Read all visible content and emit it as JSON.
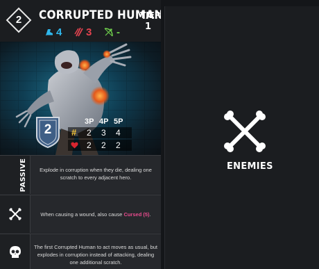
{
  "card": {
    "level": "2",
    "name": "CORRUPTED HUMAN",
    "tier_label": "TIER",
    "tier_value": "1",
    "stats": {
      "move": "4",
      "melee": "3",
      "ranged": "-"
    },
    "defense": "2",
    "player_counts": [
      "3P",
      "4P",
      "5P"
    ],
    "rows": [
      {
        "icon": "hash-icon",
        "values": [
          "2",
          "3",
          "4"
        ]
      },
      {
        "icon": "heart-icon",
        "values": [
          "2",
          "2",
          "2"
        ]
      }
    ],
    "abilities": [
      {
        "label": "PASSIVE",
        "text": "Explode in corruption when they die, dealing one scratch to every adjacent hero."
      },
      {
        "label_icon": "crossed-bones-icon",
        "text_before": "When causing a wound, also cause ",
        "text_highlight": "Cursed (5)",
        "text_after": "."
      },
      {
        "label_icon": "skull-icon",
        "text": "The first Corrupted Human to act moves as usual, but explodes in corruption instead of attacking, dealing one additional scratch."
      }
    ]
  },
  "panel": {
    "label": "ENEMIES",
    "icon": "crossed-bones-icon"
  },
  "colors": {
    "move": "#2fb7ec",
    "melee": "#e3434f",
    "ranged": "#6fcf4c",
    "hash": "#f0c23a",
    "heart": "#d8252f",
    "cursed": "#e74b8d",
    "shield": "#3f5f86"
  }
}
